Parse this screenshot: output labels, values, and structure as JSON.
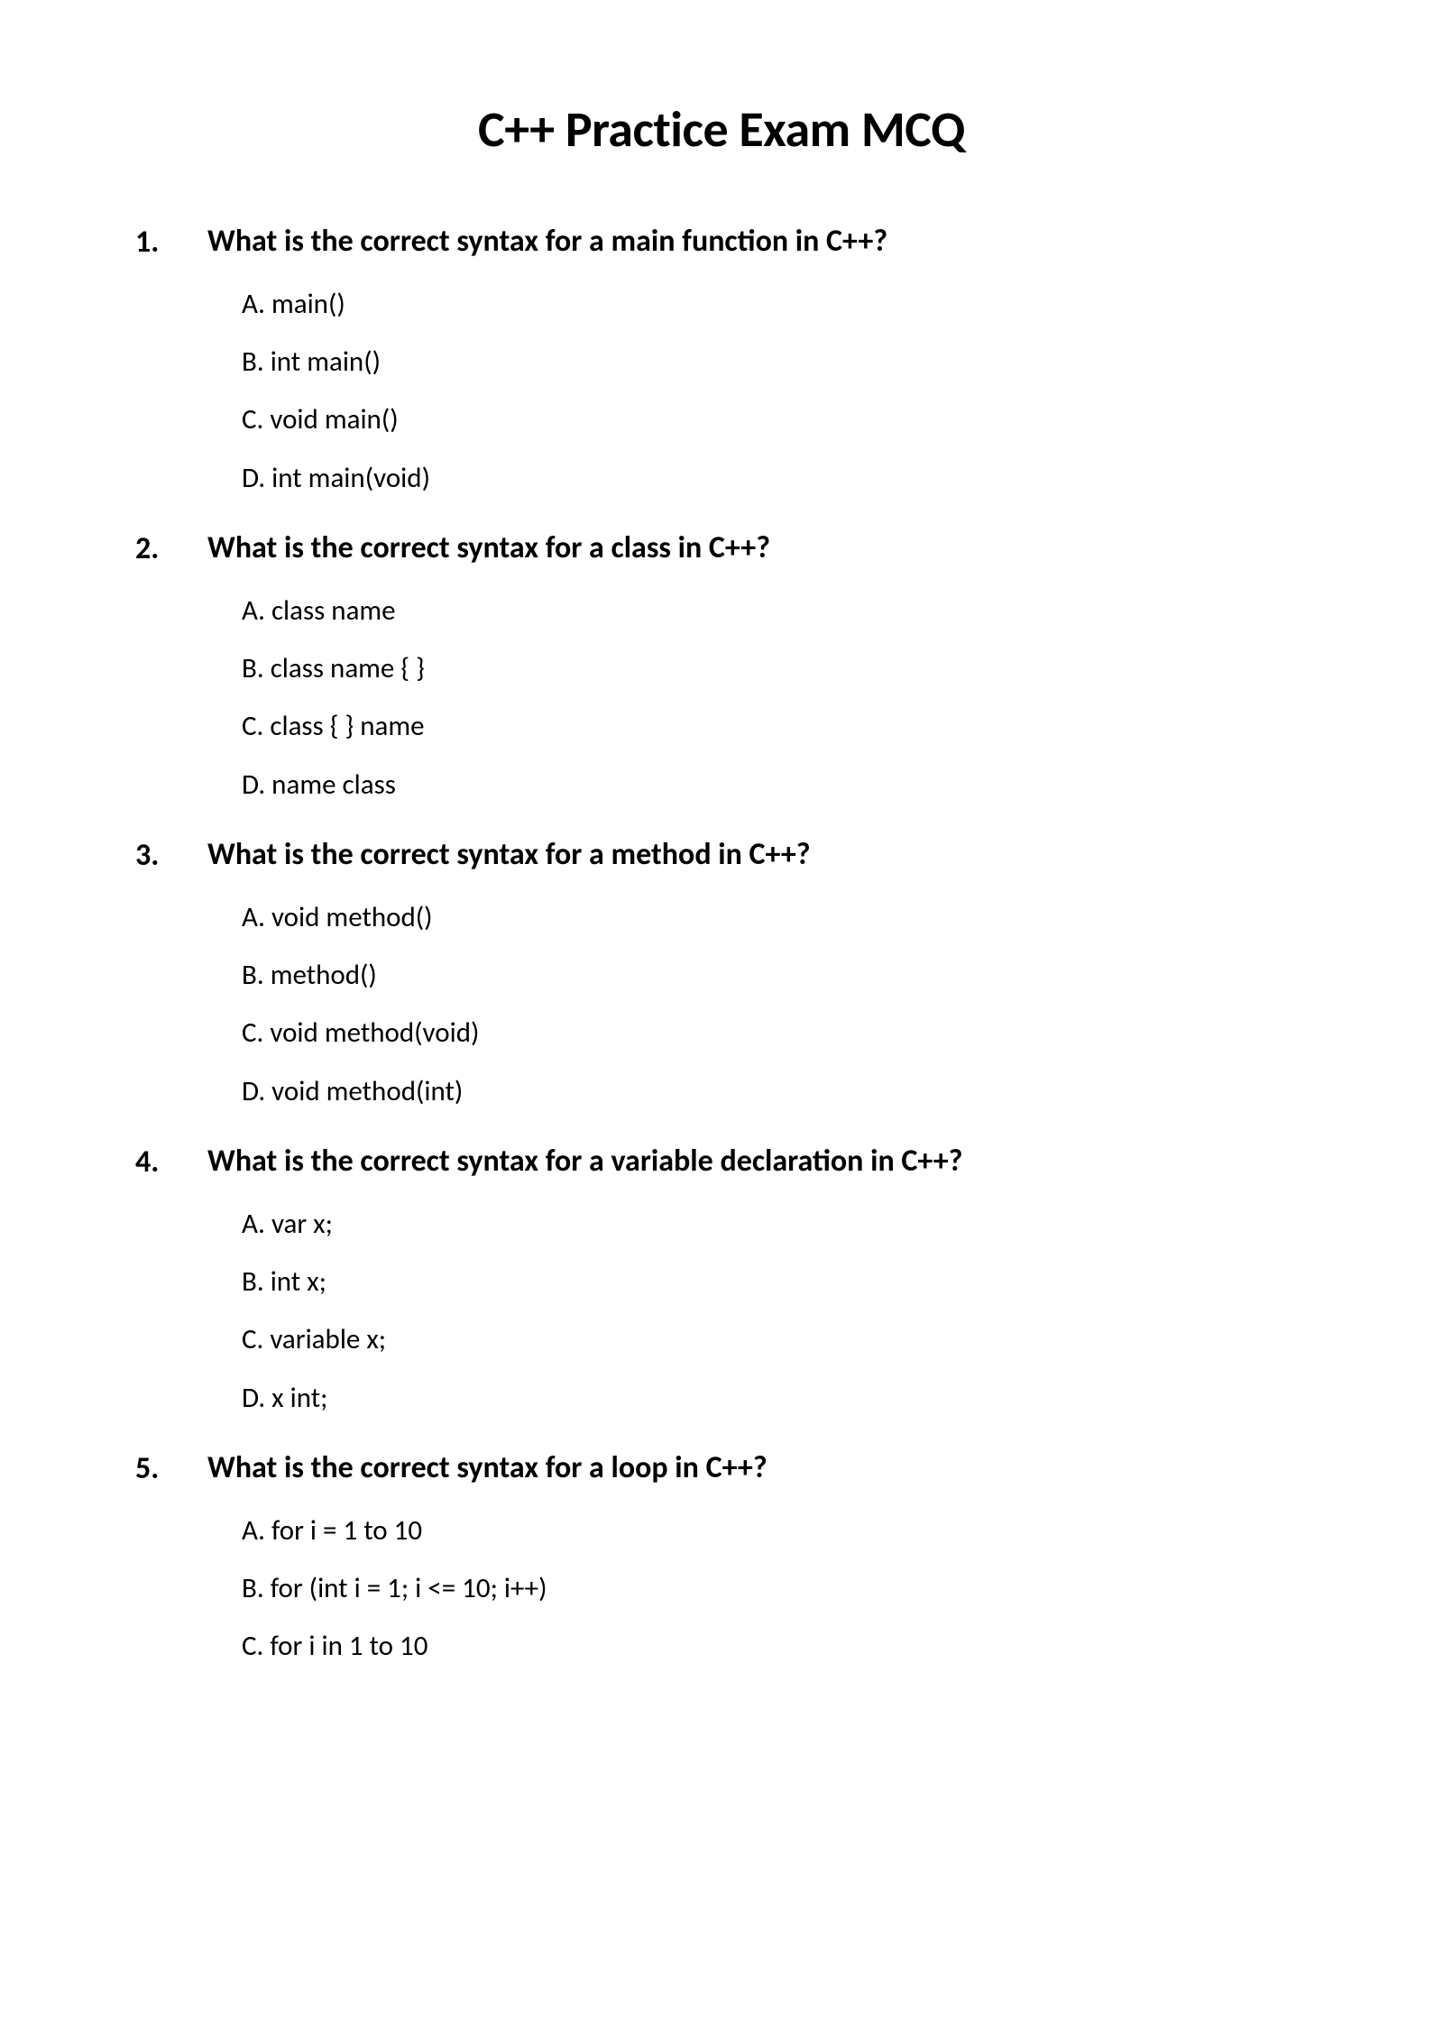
{
  "title": "C++ Practice Exam MCQ",
  "questions": [
    {
      "number": "1.",
      "text": "What is the correct syntax for a main function in C++?",
      "options": [
        "A. main()",
        "B. int main()",
        "C. void main()",
        "D. int main(void)"
      ]
    },
    {
      "number": "2.",
      "text": "What is the correct syntax for a class in C++?",
      "options": [
        "A. class name",
        "B. class name { }",
        "C. class { } name",
        "D. name class"
      ]
    },
    {
      "number": "3.",
      "text": "What is the correct syntax for a method in C++?",
      "options": [
        "A. void method()",
        "B. method()",
        "C. void method(void)",
        "D. void method(int)"
      ]
    },
    {
      "number": "4.",
      "text": "What is the correct syntax for a variable declaration in C++?",
      "options": [
        "A. var x;",
        "B. int x;",
        "C. variable x;",
        "D. x int;"
      ]
    },
    {
      "number": "5.",
      "text": "What is the correct syntax for a loop in C++?",
      "options": [
        "A. for i = 1 to 10",
        "B. for (int i = 1; i <= 10; i++)",
        "C. for i in 1 to 10"
      ]
    }
  ]
}
